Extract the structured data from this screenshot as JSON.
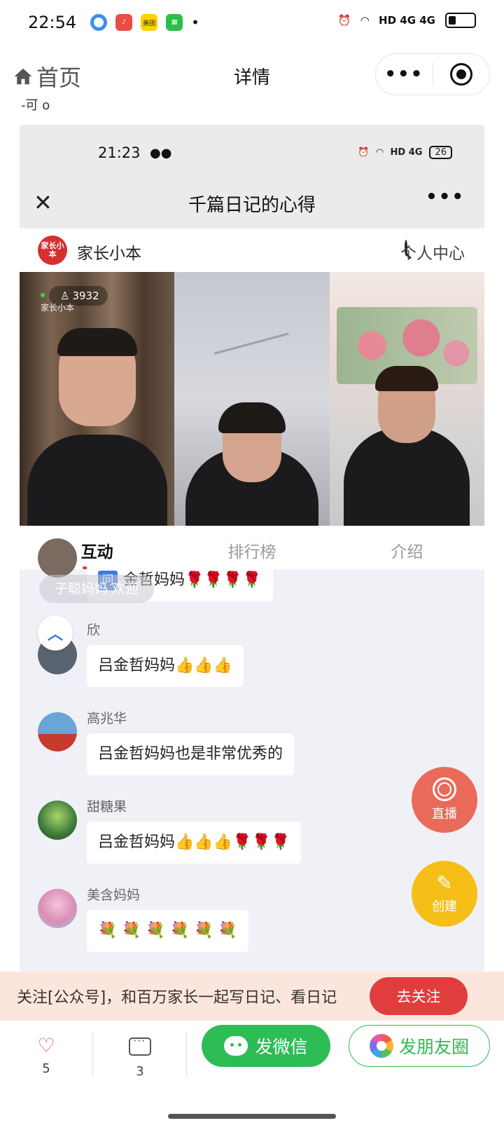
{
  "status_bar": {
    "time": "22:54",
    "app_labels": [
      "",
      "",
      "美团",
      "",
      "•"
    ],
    "network": "HD 4G 4G"
  },
  "nav": {
    "home_label": "首页",
    "title": "详情",
    "more_label": "•••"
  },
  "cut_text": "-可 o",
  "embedded": {
    "status_time": "21:23",
    "status_right": "HD 4G",
    "battery": "26",
    "title": "千篇日记的心得",
    "close_label": "✕",
    "more_label": "•••",
    "brand_logo": "家长小本",
    "brand_name": "家长小本",
    "personal_center": "个人中心",
    "live_viewers": "3932",
    "watermark": "家长小本",
    "tabs": [
      "互动",
      "排行榜",
      "介绍"
    ],
    "ghost_pill": "子聪妈妈 欢迎",
    "first_bubble_tag": "问",
    "messages": [
      {
        "user": "",
        "text": "金哲妈妈🌹🌹🌹🌹",
        "avatar_color": "#7a6a60"
      },
      {
        "user": "欣",
        "text": "吕金哲妈妈👍👍👍",
        "avatar_color": "#5a6470"
      },
      {
        "user": "高兆华",
        "text": "吕金哲妈妈也是非常优秀的",
        "avatar_color": "#c84c3c"
      },
      {
        "user": "甜糖果",
        "text": "吕金哲妈妈👍👍👍🌹🌹🌹",
        "avatar_color": "#3d7a3a"
      },
      {
        "user": "美含妈妈",
        "text": "💐 💐 💐 💐 💐 💐",
        "avatar_color": "#d98fb5"
      }
    ],
    "fab_live": "直播",
    "fab_create": "创建"
  },
  "follow_banner": {
    "text": "关注[公众号]，和百万家长一起写日记、看日记",
    "button": "去关注"
  },
  "bottom_bar": {
    "likes": "5",
    "comments": "3",
    "wechat_button": "发微信",
    "moments_button": "发朋友圈"
  },
  "colors": {
    "accent_red": "#e23d3d",
    "wechat_green": "#2ebc55",
    "fab_live": "#ea6a5a",
    "fab_create": "#f5bf17"
  }
}
